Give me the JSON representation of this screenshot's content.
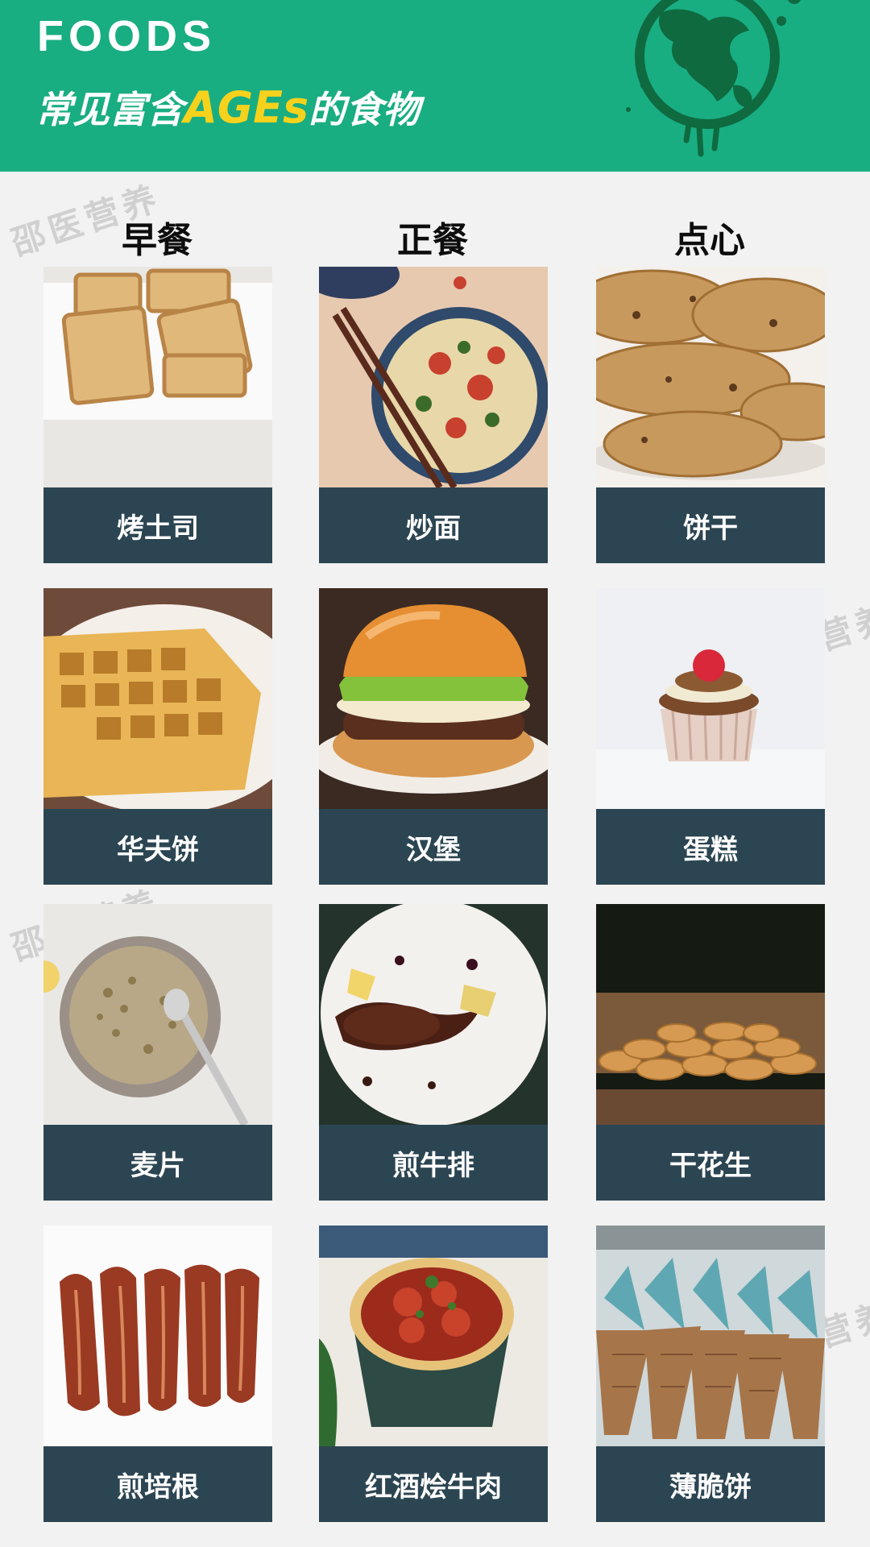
{
  "header": {
    "brand": "FOODS",
    "headline_prefix": "常见富含",
    "headline_highlight": "AGEs",
    "headline_suffix": "的食物"
  },
  "watermark": "邵医营养",
  "columns": [
    "早餐",
    "正餐",
    "点心"
  ],
  "items": [
    {
      "label": "烤土司",
      "icon": "toast-photo"
    },
    {
      "label": "炒面",
      "icon": "noodles-photo"
    },
    {
      "label": "饼干",
      "icon": "cookies-photo"
    },
    {
      "label": "华夫饼",
      "icon": "waffle-photo"
    },
    {
      "label": "汉堡",
      "icon": "burger-photo"
    },
    {
      "label": "蛋糕",
      "icon": "cupcake-photo"
    },
    {
      "label": "麦片",
      "icon": "cereal-photo"
    },
    {
      "label": "煎牛排",
      "icon": "steak-photo"
    },
    {
      "label": "干花生",
      "icon": "peanuts-photo"
    },
    {
      "label": "煎培根",
      "icon": "bacon-photo"
    },
    {
      "label": "红酒烩牛肉",
      "icon": "stew-photo"
    },
    {
      "label": "薄脆饼",
      "icon": "cone-photo"
    }
  ],
  "colors": {
    "header_bg": "#19ad82",
    "highlight": "#f6d21c",
    "label_bg": "#2c4552",
    "page_bg": "#f2f2f2"
  }
}
